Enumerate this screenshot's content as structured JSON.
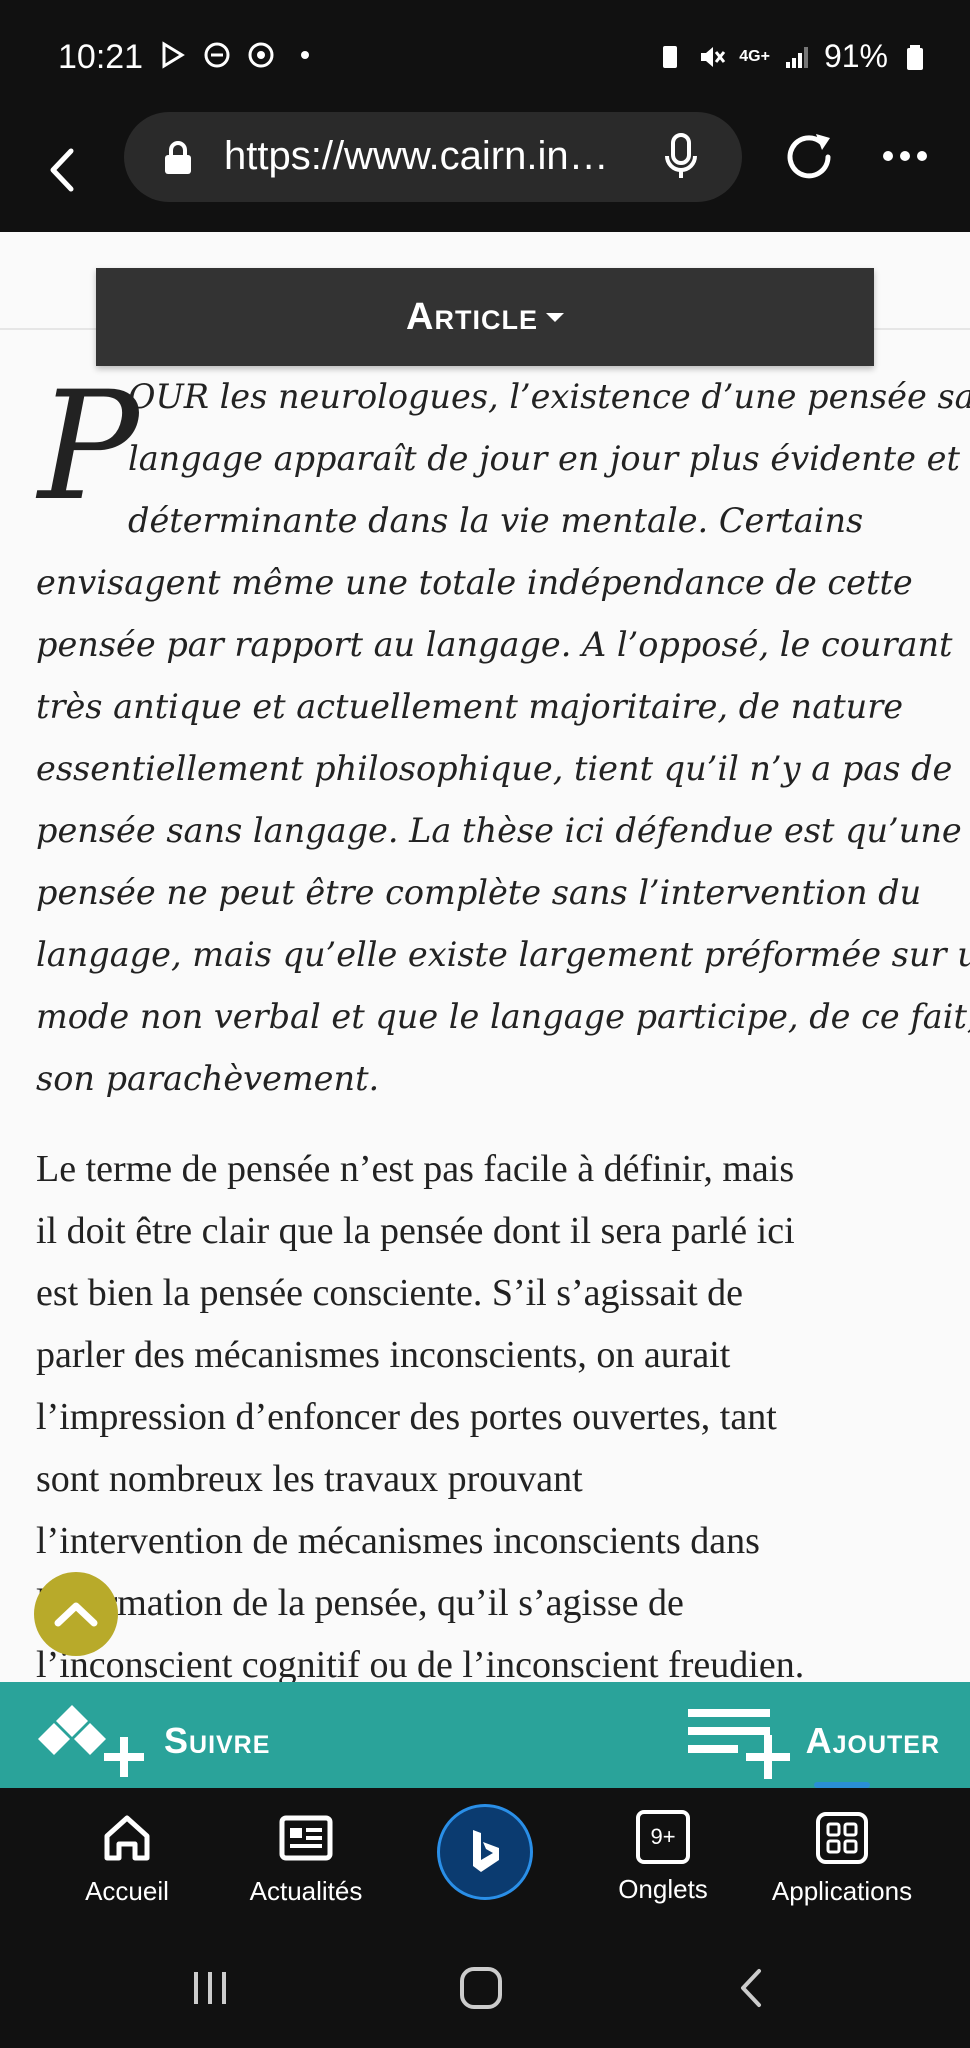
{
  "status_bar": {
    "time": "10:21",
    "network": "4G+",
    "battery": "91%"
  },
  "browser": {
    "url": "https://www.cairn.in…",
    "icons": [
      "back-icon",
      "lock-icon",
      "mic-icon",
      "reload-icon",
      "more-icon"
    ]
  },
  "article_tab": {
    "label": "Article"
  },
  "abstract": {
    "dropcap": "P",
    "lines": [
      "OUR les neurologues, l’existence d’une pensée sans",
      "langage apparaît de jour en jour plus évidente et",
      "déterminante dans la vie mentale. Certains",
      "envisagent même une totale indépendance de cette",
      "pensée par rapport au langage. A l’opposé, le courant",
      "très antique et actuellement majoritaire, de nature",
      "essentiellement philosophique, tient qu’il n’y a pas de",
      "pensée sans langage. La thèse ici défendue est qu’une",
      "pensée ne peut être complète sans l’intervention du",
      "langage, mais qu’elle existe largement préformée sur un",
      "mode non verbal et que le langage participe, de ce fait, à",
      "son parachèvement."
    ]
  },
  "body": {
    "lines": [
      "Le terme de pensée n’est pas facile à définir, mais",
      "il doit être clair que la pensée dont il sera parlé ici",
      "est bien la pensée consciente. S’il s’agissait de",
      "parler des mécanismes inconscients, on aurait",
      "l’impression d’enfoncer des portes ouvertes, tant",
      "sont nombreux les travaux prouvant",
      "l’intervention de mécanismes inconscients dans",
      "la formation de la pensée, qu’il s’agisse de",
      "l’inconscient cognitif ou de l’inconscient freudien."
    ]
  },
  "action_bar": {
    "follow_label": "Suivre",
    "add_label": "Ajouter"
  },
  "bottom_nav": {
    "items": [
      {
        "label": "Accueil",
        "icon": "home-icon"
      },
      {
        "label": "Actualités",
        "icon": "news-icon"
      },
      {
        "label": "Onglets",
        "icon": "tabs-icon",
        "badge": "9+"
      },
      {
        "label": "Applications",
        "icon": "apps-icon"
      }
    ]
  },
  "colors": {
    "teal": "#2aa39a",
    "scroll_button": "#b8aa2a",
    "bing_blue": "#2a8fe8"
  }
}
